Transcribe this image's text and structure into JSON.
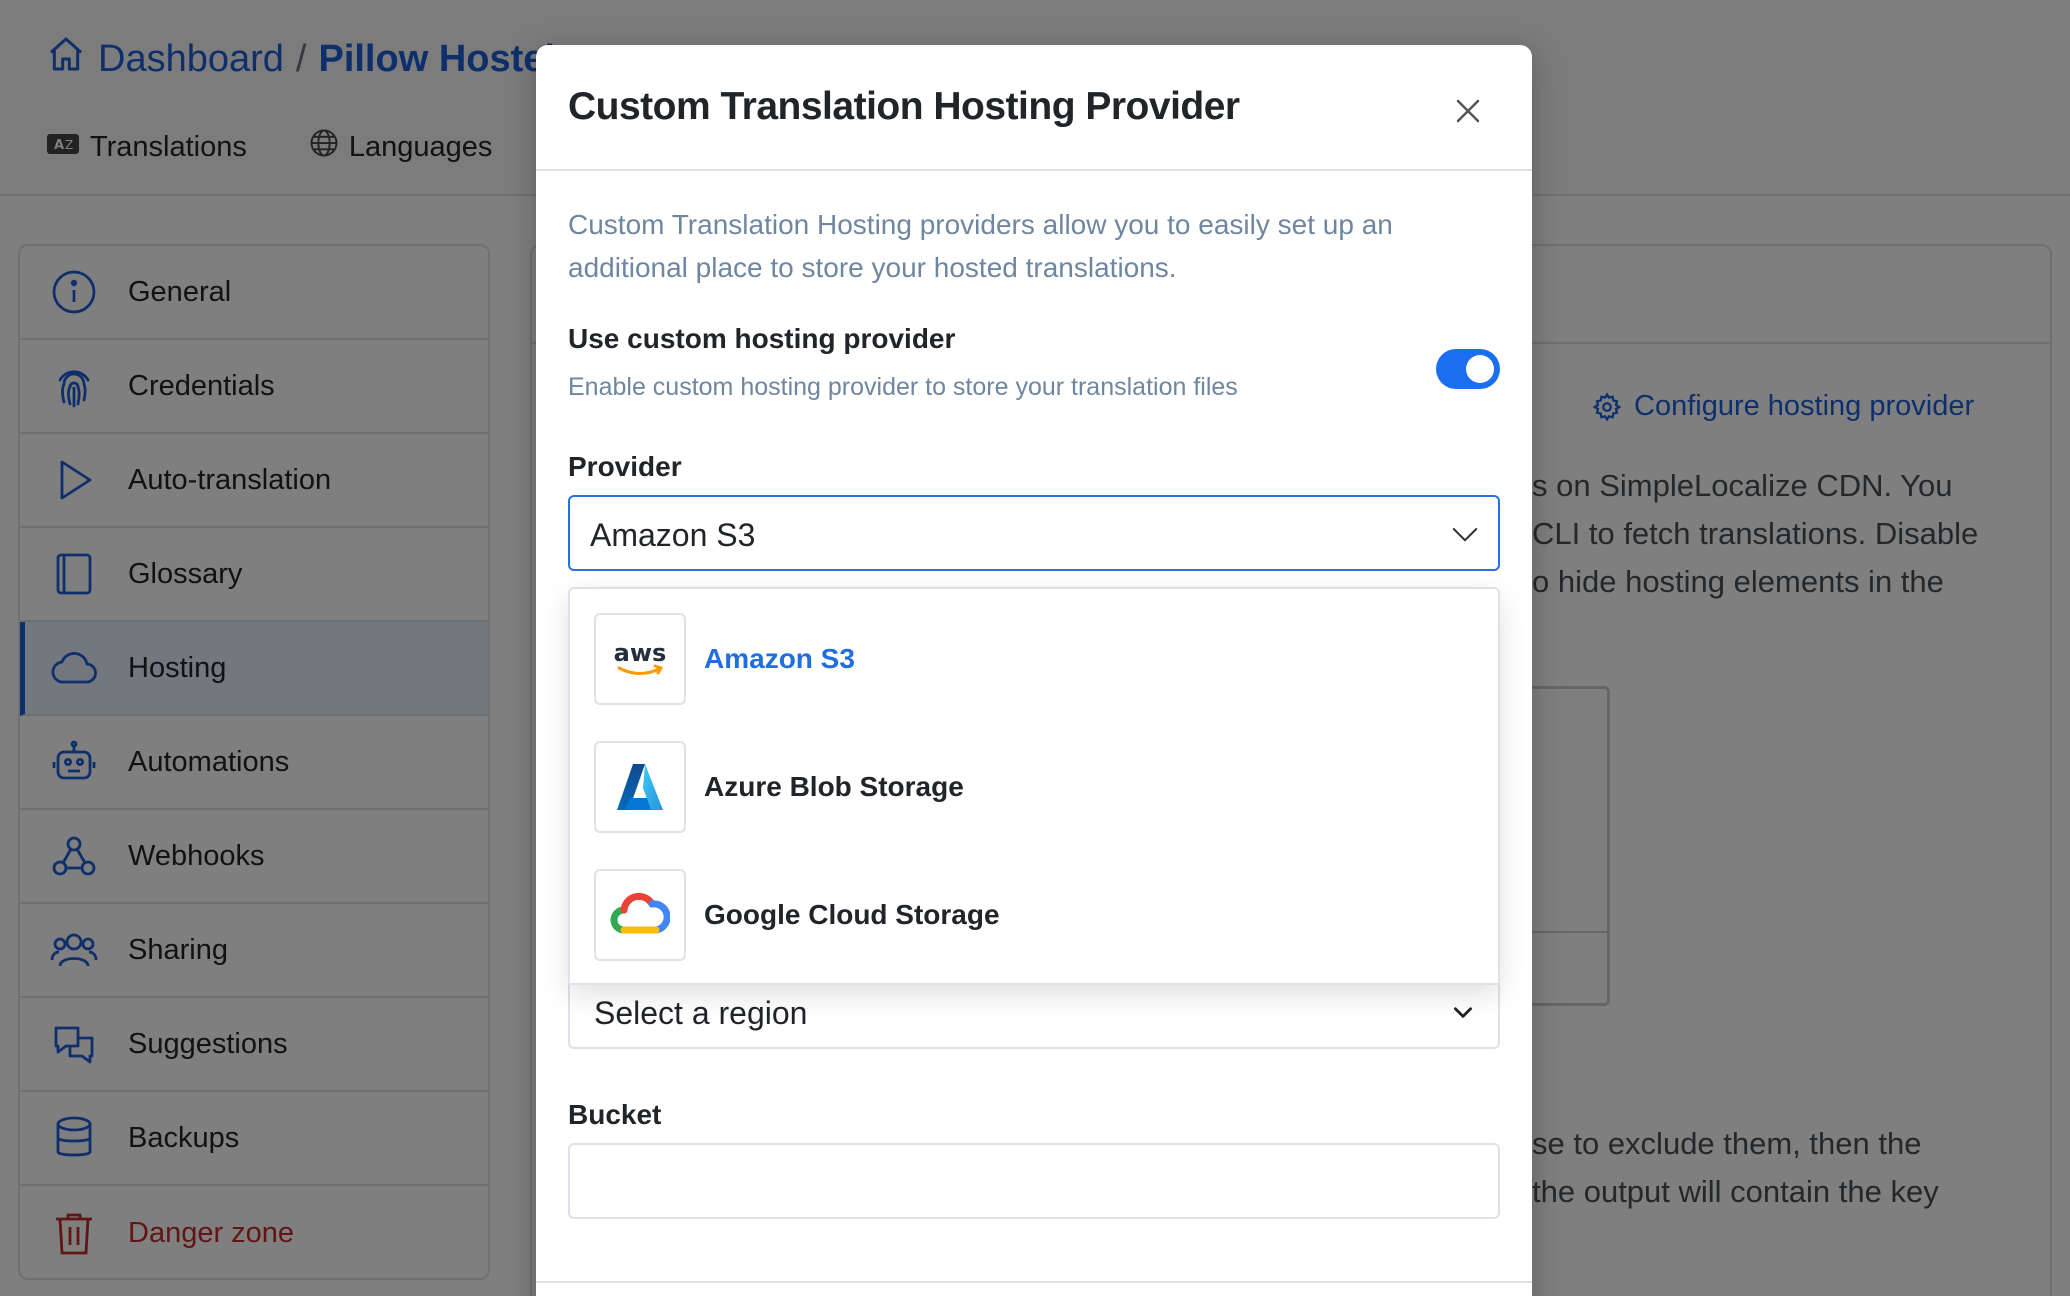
{
  "breadcrumb": {
    "root": "Dashboard",
    "separator": "/",
    "current": "Pillow Hostel"
  },
  "tabs": [
    {
      "label": "Translations",
      "icon": "translate-icon"
    },
    {
      "label": "Languages",
      "icon": "globe-icon"
    }
  ],
  "sidebar": {
    "items": [
      {
        "label": "General",
        "icon": "info-icon"
      },
      {
        "label": "Credentials",
        "icon": "fingerprint-icon"
      },
      {
        "label": "Auto-translation",
        "icon": "play-icon"
      },
      {
        "label": "Glossary",
        "icon": "book-icon"
      },
      {
        "label": "Hosting",
        "icon": "cloud-icon",
        "active": true
      },
      {
        "label": "Automations",
        "icon": "robot-icon"
      },
      {
        "label": "Webhooks",
        "icon": "webhook-icon"
      },
      {
        "label": "Sharing",
        "icon": "people-icon"
      },
      {
        "label": "Suggestions",
        "icon": "chat-icon"
      },
      {
        "label": "Backups",
        "icon": "database-icon"
      },
      {
        "label": "Danger zone",
        "icon": "trash-icon",
        "danger": true
      }
    ]
  },
  "background": {
    "configure_link": "Configure hosting provider",
    "partial_lines": [
      "s on SimpleLocalize CDN. You",
      "CLI to fetch translations. Disable",
      "o hide hosting elements in the"
    ],
    "partial_lines_bottom": [
      "se to exclude them, then the",
      " the output will contain the key"
    ]
  },
  "modal": {
    "title": "Custom Translation Hosting Provider",
    "description": "Custom Translation Hosting providers allow you to easily set up an additional place to store your hosted translations.",
    "use_custom": {
      "label": "Use custom hosting provider",
      "help": "Enable custom hosting provider to store your translation files",
      "enabled": true
    },
    "provider": {
      "label": "Provider",
      "value": "Amazon S3",
      "options": [
        {
          "label": "Amazon S3",
          "logo": "aws-logo",
          "selected": true
        },
        {
          "label": "Azure Blob Storage",
          "logo": "azure-logo",
          "selected": false
        },
        {
          "label": "Google Cloud Storage",
          "logo": "google-cloud-logo",
          "selected": false
        }
      ]
    },
    "region": {
      "placeholder": "Select a region"
    },
    "bucket": {
      "label": "Bucket",
      "value": ""
    }
  },
  "colors": {
    "accent": "#1f5fd6",
    "toggle": "#1a6ef0",
    "danger": "#c52a2a",
    "muted": "#6f86a0"
  }
}
